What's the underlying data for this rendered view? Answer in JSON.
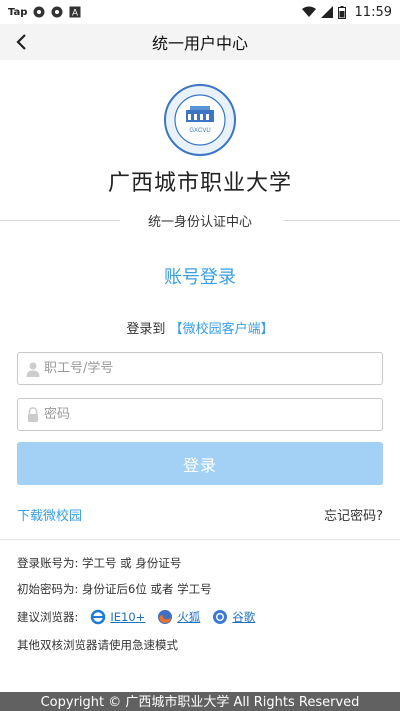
{
  "status_bar": {
    "app_label": "Tap",
    "icons": [
      "settings-icon",
      "settings-icon",
      "font-icon"
    ],
    "right_icons": [
      "wifi-icon",
      "signal-icon",
      "battery-icon"
    ],
    "time": "11:59"
  },
  "header": {
    "title": "统一用户中心",
    "back_icon": "back-arrow-icon",
    "background": "#f4f4f4"
  },
  "brand": {
    "logo_text": "GXCVU",
    "university_name": "广西城市职业大学",
    "subtitle": "统一身份认证中心"
  },
  "login": {
    "title": "账号登录",
    "to_prefix": "登录到",
    "to_target": "【微校园客户端】",
    "username_placeholder": "职工号/学号",
    "password_placeholder": "密码",
    "submit_label": "登录",
    "download_link": "下载微校园",
    "forgot_link": "忘记密码?",
    "accent_color": "#3a9ee4",
    "button_color": "#a3d1f6"
  },
  "info": {
    "account_line": "登录账号为:  学工号 或 身份证号",
    "password_line": "初始密码为:  身份证后6位 或者 学工号",
    "browser_prefix": "建议浏览器:",
    "browsers": [
      {
        "label": "IE10+",
        "icon": "ie-icon"
      },
      {
        "label": "火狐",
        "icon": "firefox-icon"
      },
      {
        "label": "谷歌",
        "icon": "chrome-icon"
      }
    ],
    "note": "其他双核浏览器请使用急速模式"
  },
  "footer": {
    "text": "Copyright © 广西城市职业大学 All Rights Reserved"
  }
}
